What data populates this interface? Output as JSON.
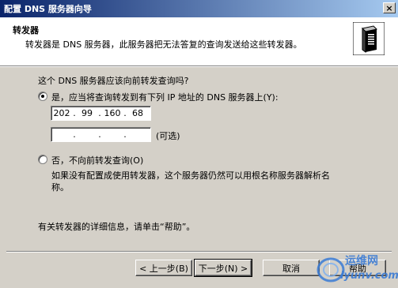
{
  "window": {
    "title": "配置 DNS 服务器向导",
    "close_glyph": "×"
  },
  "header": {
    "title": "转发器",
    "subtitle": "转发器是 DNS 服务器，此服务器把无法答复的查询发送给这些转发器。",
    "icon": "server-icon"
  },
  "body": {
    "question": "这个 DNS 服务器应该向前转发查询吗?",
    "option_yes": "是，应当将查询转发到有下列 IP 地址的 DNS 服务器上(Y):",
    "option_yes_selected": true,
    "ip1": {
      "o1": "202",
      "o2": "99",
      "o3": "160",
      "o4": "68"
    },
    "ip2": {
      "o1": "",
      "o2": "",
      "o3": "",
      "o4": ""
    },
    "ip_dot": ".",
    "optional_label": "(可选)",
    "option_no": "否，不向前转发查询(O)",
    "option_no_selected": false,
    "no_desc_line1": "如果没有配置成使用转发器，这个服务器仍然可以用根名称服务器解析名",
    "no_desc_line2": "称。",
    "help_note": "有关转发器的详细信息，请单击“帮助”。"
  },
  "buttons": {
    "back": "< 上一步(B)",
    "next": "下一步(N) >",
    "cancel": "取消",
    "help": "帮助"
  },
  "watermark": {
    "line1": "运维网",
    "line2": "iyunv.com"
  },
  "colors": {
    "title_gradient_start": "#0a246a",
    "title_gradient_end": "#a6caf0",
    "dialog_face": "#d4d0c8",
    "watermark_blue": "#3a7bd5"
  }
}
